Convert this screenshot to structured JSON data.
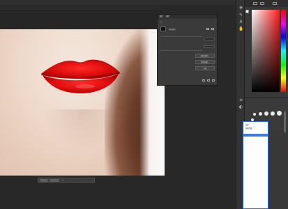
{
  "colors": {
    "app_bg": "#282828",
    "panel_bg": "#3a3a3a",
    "lip_red": "#d90f0f",
    "selection_blue": "#3d7ae0",
    "foreground_swatch": "#ffffff"
  },
  "properties_panel": {
    "tabs": [
      "属性",
      "调整"
    ],
    "row_labels": [
      "颜色填充",
      "",
      "",
      "",
      "",
      ""
    ],
    "buttons": [
      "选择并遮住...",
      "颜色范围...",
      "反相"
    ]
  },
  "context_bar": {
    "labels": [
      "选择主体",
      "选择并遮住"
    ]
  },
  "tool_icons": [
    "move-icon",
    "brush-icon",
    "type-icon",
    "hand-icon",
    "layers-icon",
    "adjust-icon"
  ],
  "preset_list": {
    "items": [
      "选区",
      "图层蒙版",
      "",
      "",
      "",
      "",
      "",
      "",
      "",
      "",
      "",
      "",
      "",
      "",
      "",
      "",
      "",
      "",
      "",
      "",
      "",
      "",
      "",
      ""
    ]
  }
}
